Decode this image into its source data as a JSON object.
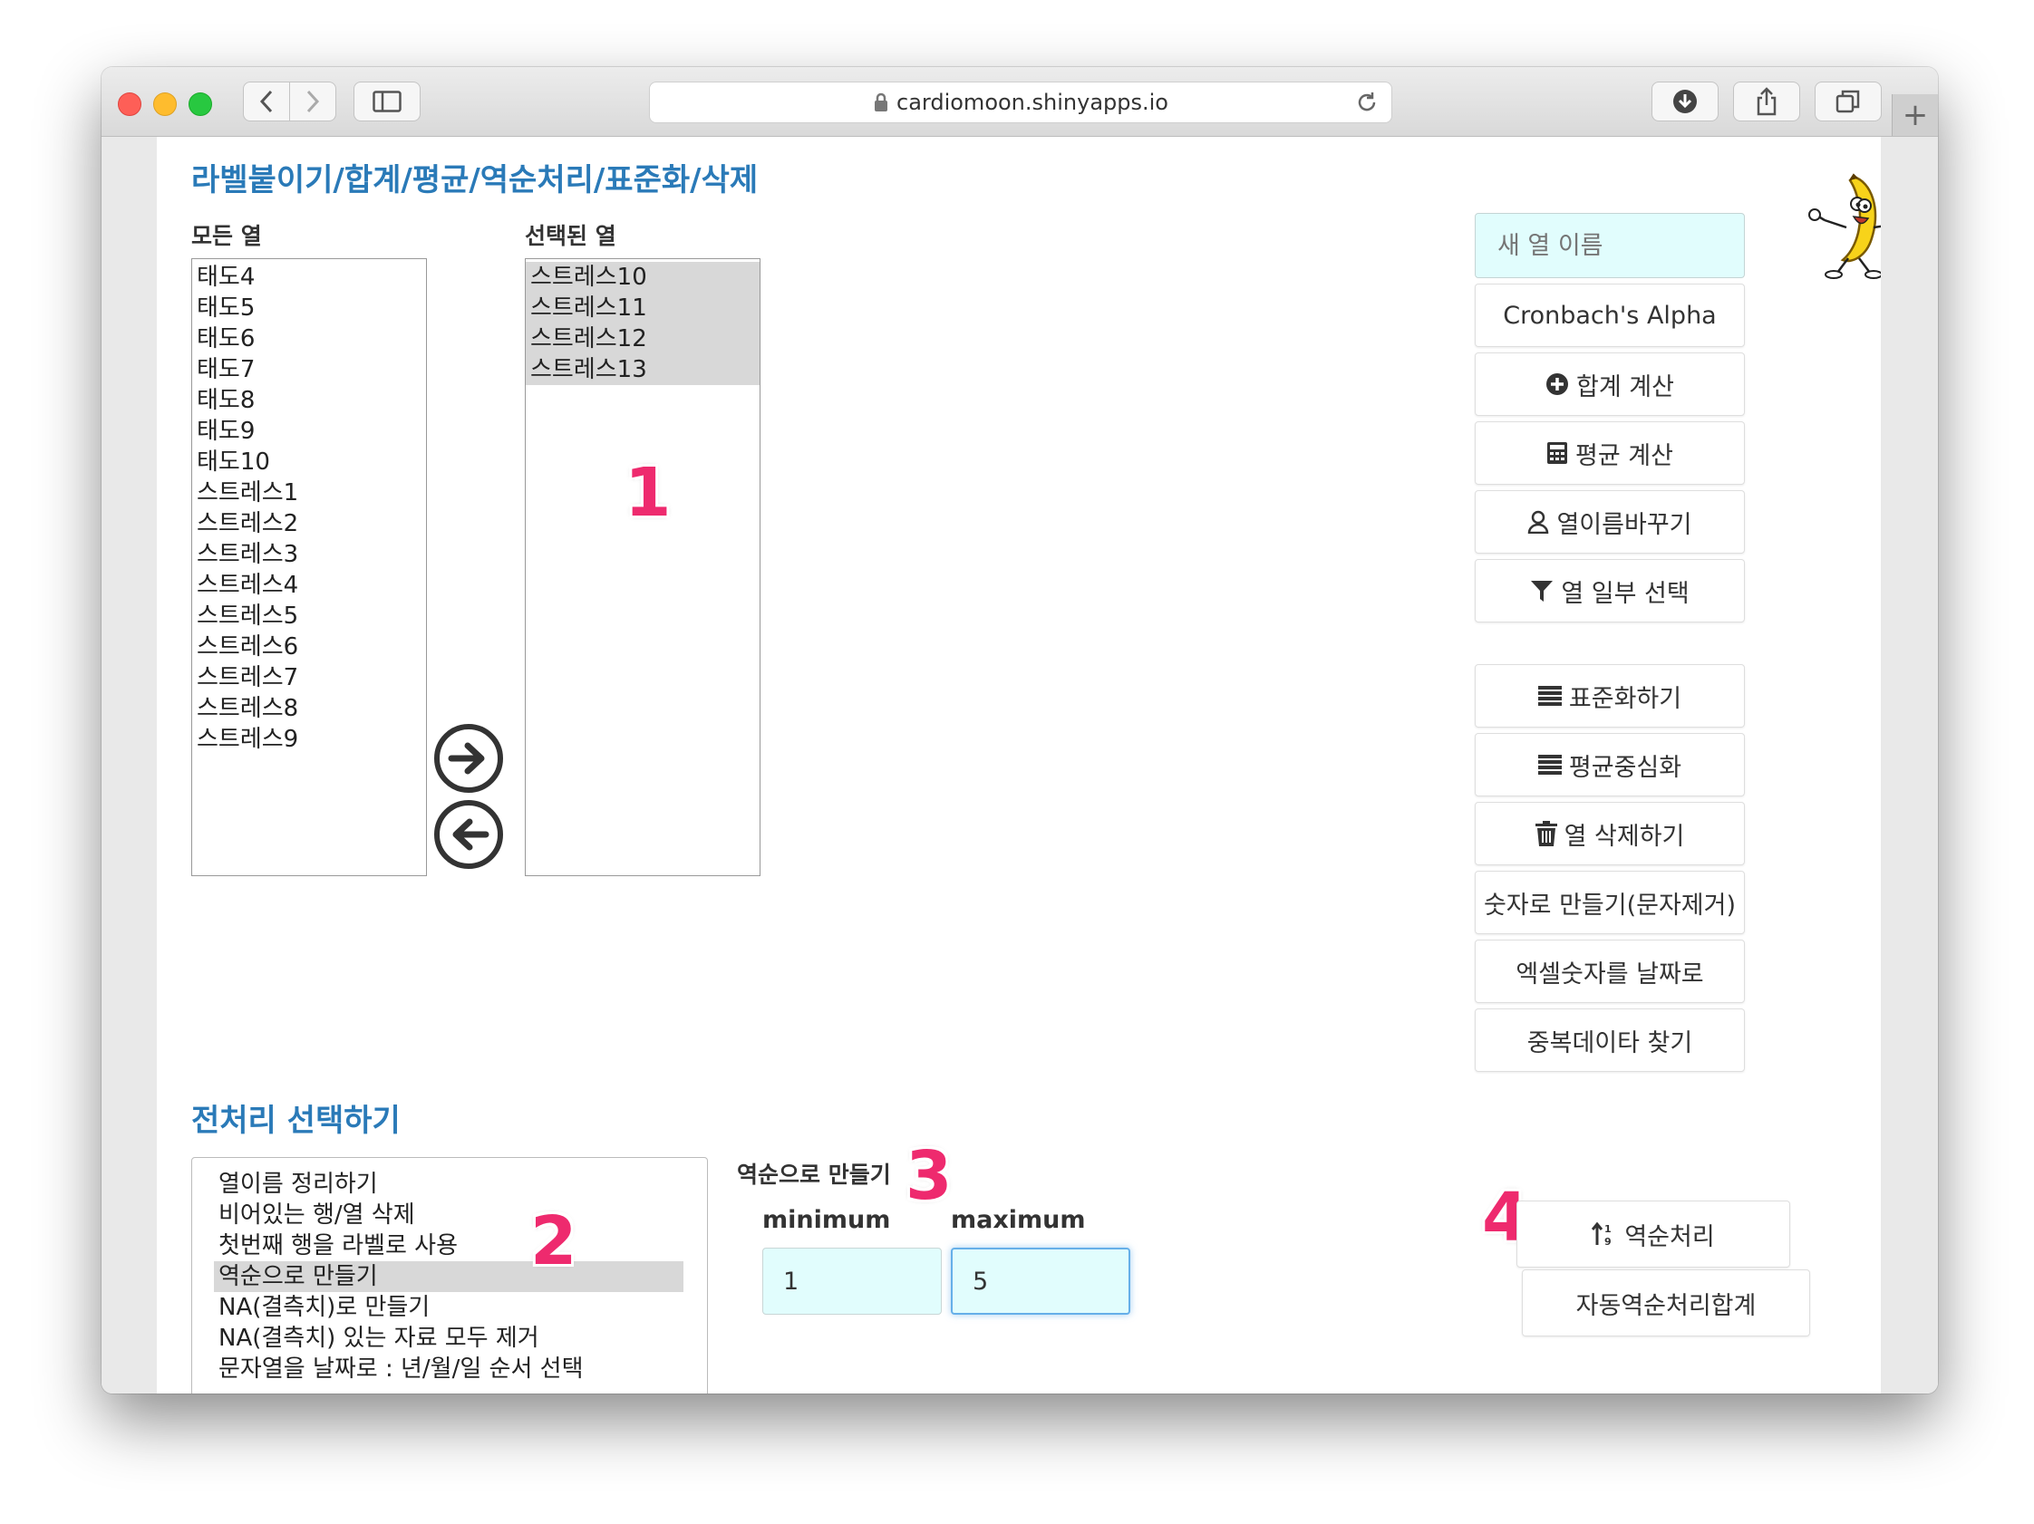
{
  "browser": {
    "url": "cardiomoon.shinyapps.io"
  },
  "labels_section": {
    "title": "라벨붙이기/합계/평균/역순처리/표준화/삭제",
    "all_columns_label": "모든 열",
    "all_columns": [
      "태도4",
      "태도5",
      "태도6",
      "태도7",
      "태도8",
      "태도9",
      "태도10",
      "스트레스1",
      "스트레스2",
      "스트레스3",
      "스트레스4",
      "스트레스5",
      "스트레스6",
      "스트레스7",
      "스트레스8",
      "스트레스9"
    ],
    "selected_columns_label": "선택된 열",
    "selected_columns": [
      "스트레스10",
      "스트레스11",
      "스트레스12",
      "스트레스13"
    ]
  },
  "side_panel": {
    "new_column_placeholder": "새 열 이름",
    "buttons": [
      {
        "label": "Cronbach's Alpha",
        "icon": "none"
      },
      {
        "label": "합계 계산",
        "icon": "plus-circle-icon"
      },
      {
        "label": "평균 계산",
        "icon": "calculator-icon"
      },
      {
        "label": "열이름바꾸기",
        "icon": "user-icon"
      },
      {
        "label": "열 일부 선택",
        "icon": "filter-icon"
      },
      {
        "label": "표준화하기",
        "icon": "list-icon"
      },
      {
        "label": "평균중심화",
        "icon": "list-icon"
      },
      {
        "label": "열 삭제하기",
        "icon": "trash-icon"
      },
      {
        "label": "숫자로 만들기(문자제거)",
        "icon": "none"
      },
      {
        "label": "엑셀숫자를 날짜로",
        "icon": "none"
      },
      {
        "label": "중복데이타 찾기",
        "icon": "none"
      }
    ]
  },
  "preprocess": {
    "title": "전처리 선택하기",
    "options": [
      "열이름 정리하기",
      "비어있는 행/열 삭제",
      "첫번째 행을 라벨로 사용",
      "역순으로 만들기",
      "NA(결측치)로 만들기",
      "NA(결측치) 있는 자료 모두 제거",
      "문자열을 날짜로 : 년/월/일 순서 선택"
    ],
    "selected_index": 3,
    "reverse_label": "역순으로 만들기",
    "minimum_label": "minimum",
    "maximum_label": "maximum",
    "minimum_value": "1",
    "maximum_value": "5",
    "reverse_button": "역순처리",
    "auto_reverse_button": "자동역순처리합계"
  },
  "markers": [
    "1",
    "2",
    "3",
    "4"
  ],
  "colors": {
    "heading": "#2a7ab8",
    "marker": "#ee2a6e",
    "input_bg": "#e1fdfd"
  }
}
